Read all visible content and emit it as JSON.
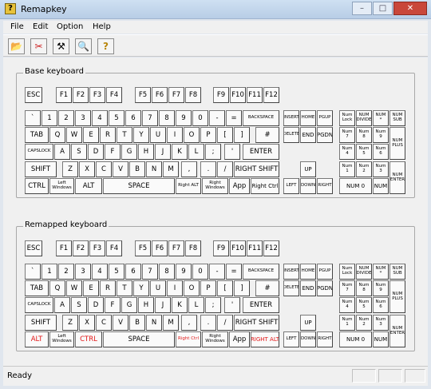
{
  "window": {
    "title": "Remapkey",
    "app_icon": "?",
    "minimize": "–",
    "maximize": "□",
    "close": "✕"
  },
  "menu": {
    "file": "File",
    "edit": "Edit",
    "option": "Option",
    "help": "Help"
  },
  "toolbar": {
    "open": "📂",
    "clear": "✂",
    "run": "⚒",
    "view": "🔍",
    "help": "?"
  },
  "base": {
    "label": "Base keyboard",
    "keys": {
      "esc": "ESC",
      "f1": "F1",
      "f2": "F2",
      "f3": "F3",
      "f4": "F4",
      "f5": "F5",
      "f6": "F6",
      "f7": "F7",
      "f8": "F8",
      "f9": "F9",
      "f10": "F10",
      "f11": "F11",
      "f12": "F12",
      "grave": "`",
      "n1": "1",
      "n2": "2",
      "n3": "3",
      "n4": "4",
      "n5": "5",
      "n6": "6",
      "n7": "7",
      "n8": "8",
      "n9": "9",
      "n0": "0",
      "minus": "-",
      "equal": "=",
      "backspace": "BACKSPACE",
      "tab": "TAB",
      "q": "Q",
      "w": "W",
      "e": "E",
      "r": "R",
      "t": "T",
      "y": "Y",
      "u": "U",
      "i": "I",
      "o": "O",
      "p": "P",
      "lbr": "[",
      "rbr": "]",
      "hash": "#",
      "caps": "CAPSLOCK",
      "a": "A",
      "s": "S",
      "d": "D",
      "f": "F",
      "g": "G",
      "h": "H",
      "j": "J",
      "k": "K",
      "l": "L",
      "semi": ";",
      "quote": "'",
      "enter": "ENTER",
      "lshift": "SHIFT",
      "z": "Z",
      "x": "X",
      "c": "C",
      "v": "V",
      "b": "B",
      "n": "N",
      "m": "M",
      "comma": ",",
      "period": ".",
      "slash": "/",
      "rshift": "RIGHT SHIFT",
      "lctrl": "CTRL",
      "lwin": "Left Windows",
      "lalt": "ALT",
      "space": "SPACE",
      "ralt": "Right ALT",
      "rwin": "Right Windows",
      "app": "App",
      "rctrl": "Right Ctrl",
      "ins": "INSERT",
      "home": "HOME",
      "pgup": "PGUP",
      "del": "DELETE",
      "end": "END",
      "pgdn": "PGDN",
      "up": "UP",
      "left": "LEFT",
      "down": "DOWN",
      "right": "RIGHT",
      "numlock": "Num Lock",
      "numdiv": "NUM DIVIDE",
      "nummul": "NUM *",
      "numsub": "NUM SUB",
      "num7": "Num 7",
      "num8": "Num 8",
      "num9": "Num 9",
      "numplus": "NUM PLUS",
      "num4": "Num 4",
      "num5": "Num 5",
      "num6": "Num 6",
      "num1": "Num 1",
      "num2": "Num 2",
      "num3": "Num 3",
      "numenter": "NUM ENTER",
      "num0": "NUM 0",
      "numdot": "NUM"
    }
  },
  "remapped": {
    "label": "Remapped keyboard",
    "keys": {
      "esc": "ESC",
      "f1": "F1",
      "f2": "F2",
      "f3": "F3",
      "f4": "F4",
      "f5": "F5",
      "f6": "F6",
      "f7": "F7",
      "f8": "F8",
      "f9": "F9",
      "f10": "F10",
      "f11": "F11",
      "f12": "F12",
      "grave": "`",
      "n1": "1",
      "n2": "2",
      "n3": "3",
      "n4": "4",
      "n5": "5",
      "n6": "6",
      "n7": "7",
      "n8": "8",
      "n9": "9",
      "n0": "0",
      "minus": "-",
      "equal": "=",
      "backspace": "BACKSPACE",
      "tab": "TAB",
      "q": "Q",
      "w": "W",
      "e": "E",
      "r": "R",
      "t": "T",
      "y": "Y",
      "u": "U",
      "i": "I",
      "o": "O",
      "p": "P",
      "lbr": "[",
      "rbr": "]",
      "hash": "#",
      "caps": "CAPSLOCK",
      "a": "A",
      "s": "S",
      "d": "D",
      "f": "F",
      "g": "G",
      "h": "H",
      "j": "J",
      "k": "K",
      "l": "L",
      "semi": ";",
      "quote": "'",
      "enter": "ENTER",
      "lshift": "SHIFT",
      "z": "Z",
      "x": "X",
      "c": "C",
      "v": "V",
      "b": "B",
      "n": "N",
      "m": "M",
      "comma": ",",
      "period": ".",
      "slash": "/",
      "rshift": "RIGHT SHIFT",
      "lctrl": "ALT",
      "lwin": "Left Windows",
      "lalt": "CTRL",
      "space": "SPACE",
      "ralt": "Right Ctrl",
      "rwin": "Right Windows",
      "app": "App",
      "rctrl": "RIGHT ALT",
      "ins": "INSERT",
      "home": "HOME",
      "pgup": "PGUP",
      "del": "DELETE",
      "end": "END",
      "pgdn": "PGDN",
      "up": "UP",
      "left": "LEFT",
      "down": "DOWN",
      "right": "RIGHT",
      "numlock": "Num Lock",
      "numdiv": "NUM DIVIDE",
      "nummul": "NUM *",
      "numsub": "NUM SUB",
      "num7": "Num 7",
      "num8": "Num 8",
      "num9": "Num 9",
      "numplus": "NUM PLUS",
      "num4": "Num 4",
      "num5": "Num 5",
      "num6": "Num 6",
      "num1": "Num 1",
      "num2": "Num 2",
      "num3": "Num 3",
      "numenter": "NUM ENTER",
      "num0": "NUM 0",
      "numdot": "NUM"
    },
    "changed": [
      "lctrl",
      "lalt",
      "ralt",
      "rctrl"
    ],
    "changed_color": "#e21515"
  },
  "status": {
    "text": "Ready"
  }
}
